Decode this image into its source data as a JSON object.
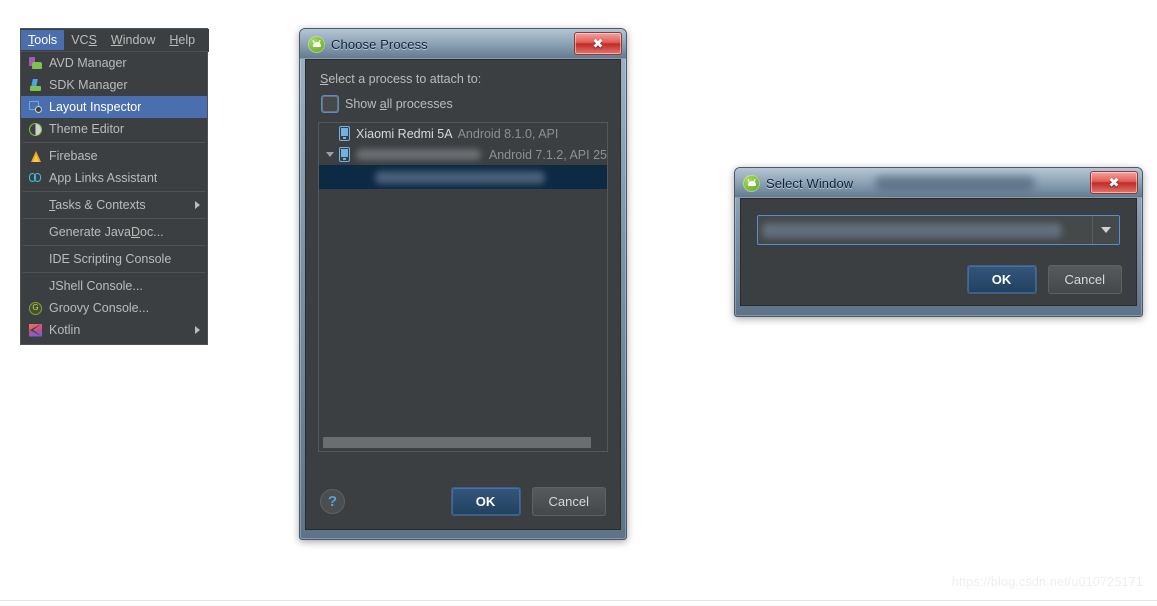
{
  "menu": {
    "menubar": [
      {
        "label": "Tools",
        "mnemonic": "T",
        "active": true
      },
      {
        "label": "VCS",
        "mnemonic": "S",
        "active": false
      },
      {
        "label": "Window",
        "mnemonic": "W",
        "active": false
      },
      {
        "label": "Help",
        "mnemonic": "H",
        "active": false
      }
    ],
    "items": [
      {
        "label": "AVD Manager",
        "icon": "avd-manager-icon",
        "selected": false
      },
      {
        "label": "SDK Manager",
        "icon": "sdk-manager-icon",
        "selected": false
      },
      {
        "label": "Layout Inspector",
        "icon": "layout-inspector-icon",
        "selected": true
      },
      {
        "label": "Theme Editor",
        "icon": "theme-editor-icon",
        "selected": false
      },
      {
        "label": "Firebase",
        "icon": "firebase-icon",
        "selected": false
      },
      {
        "label": "App Links Assistant",
        "icon": "app-links-icon",
        "selected": false
      },
      {
        "label": "Tasks & Contexts",
        "icon": "none",
        "submenu": true,
        "selected": false
      },
      {
        "label": "Generate JavaDoc...",
        "icon": "none",
        "selected": false
      },
      {
        "label": "IDE Scripting Console",
        "icon": "none",
        "selected": false
      },
      {
        "label": "JShell Console...",
        "icon": "none",
        "selected": false
      },
      {
        "label": "Groovy Console...",
        "icon": "groovy-icon",
        "selected": false
      },
      {
        "label": "Kotlin",
        "icon": "kotlin-icon",
        "submenu": true,
        "selected": false
      }
    ]
  },
  "choose_process": {
    "title": "Choose Process",
    "close_label": "✕",
    "prompt": "Select a process to attach to:",
    "prompt_mnemonic": "S",
    "show_all_label": "Show all processes",
    "show_all_mnemonic": "a",
    "show_all_checked": false,
    "rows": [
      {
        "device": "Xiaomi Redmi 5A",
        "meta": "Android 8.1.0, API",
        "redacted": false,
        "expandable": false,
        "selected": false
      },
      {
        "device": "",
        "meta": "Android 7.1.2, API 25",
        "redacted": true,
        "expandable": true,
        "selected": false
      },
      {
        "device": "",
        "meta": "",
        "redacted": true,
        "expandable": false,
        "selected": true
      }
    ],
    "help_label": "?",
    "ok_label": "OK",
    "cancel_label": "Cancel"
  },
  "select_window": {
    "title": "Select Window",
    "title_suffix_redacted": true,
    "close_label": "✕",
    "combo_value": "",
    "combo_redacted": true,
    "ok_label": "OK",
    "cancel_label": "Cancel"
  },
  "watermark": "https://blog.csdn.net/u010725171",
  "colors": {
    "menu_bg": "#3c3f41",
    "menu_selected": "#4b6eaf",
    "dialog_client_bg": "#3c3f41",
    "list_selected": "#0d2a44",
    "primary_button": "#34567d",
    "close_button": "#c12b26",
    "focus_border": "#5b8bd0"
  }
}
